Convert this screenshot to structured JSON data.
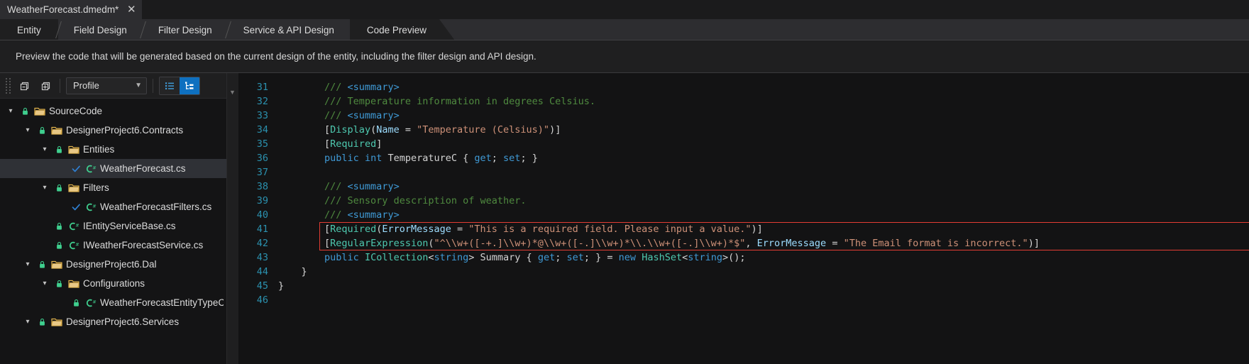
{
  "titlebar": {
    "document_tab": "WeatherForecast.dmedm*",
    "close_icon": "close-icon"
  },
  "tabs": [
    {
      "label": "Entity",
      "state": "active"
    },
    {
      "label": "Field Design",
      "state": "normal"
    },
    {
      "label": "Filter Design",
      "state": "normal"
    },
    {
      "label": "Service & API Design",
      "state": "normal"
    },
    {
      "label": "Code Preview",
      "state": "current"
    }
  ],
  "description": "Preview the code that will be generated based on the current design of the entity, including the filter design and API design.",
  "sidebar": {
    "toolbar": {
      "drag_handle": "drag-handle-icon",
      "collapse_all_icon": "collapse-all-icon",
      "expand_all_icon": "expand-all-icon",
      "profile_label": "Profile",
      "profile_chevron": "chevron-down-icon",
      "list_view_icon": "list-view-icon",
      "tree_view_icon": "tree-view-icon",
      "active_view": "tree"
    },
    "tree": [
      {
        "label": "SourceCode",
        "depth": 0,
        "kind": "folder",
        "expanded": true,
        "lock": true,
        "check": false,
        "selected": false
      },
      {
        "label": "DesignerProject6.Contracts",
        "depth": 1,
        "kind": "folder",
        "expanded": true,
        "lock": true,
        "check": false,
        "selected": false
      },
      {
        "label": "Entities",
        "depth": 2,
        "kind": "folder",
        "expanded": true,
        "lock": true,
        "check": false,
        "selected": false
      },
      {
        "label": "WeatherForecast.cs",
        "depth": 3,
        "kind": "csharp",
        "expanded": null,
        "lock": false,
        "check": true,
        "selected": true
      },
      {
        "label": "Filters",
        "depth": 2,
        "kind": "folder",
        "expanded": true,
        "lock": true,
        "check": false,
        "selected": false
      },
      {
        "label": "WeatherForecastFilters.cs",
        "depth": 3,
        "kind": "csharp",
        "expanded": null,
        "lock": false,
        "check": true,
        "selected": false
      },
      {
        "label": "IEntityServiceBase.cs",
        "depth": 2,
        "kind": "csharp",
        "expanded": null,
        "lock": true,
        "check": false,
        "selected": false
      },
      {
        "label": "IWeatherForecastService.cs",
        "depth": 2,
        "kind": "csharp",
        "expanded": null,
        "lock": true,
        "check": false,
        "selected": false
      },
      {
        "label": "DesignerProject6.Dal",
        "depth": 1,
        "kind": "folder",
        "expanded": true,
        "lock": true,
        "check": false,
        "selected": false
      },
      {
        "label": "Configurations",
        "depth": 2,
        "kind": "folder",
        "expanded": true,
        "lock": true,
        "check": false,
        "selected": false
      },
      {
        "label": "WeatherForecastEntityTypeConfig",
        "depth": 3,
        "kind": "csharp",
        "expanded": null,
        "lock": true,
        "check": false,
        "selected": false
      },
      {
        "label": "DesignerProject6.Services",
        "depth": 1,
        "kind": "folder",
        "expanded": true,
        "lock": true,
        "check": false,
        "selected": false
      }
    ]
  },
  "editor": {
    "highlight_color": "#e23c33",
    "highlighted_lines": [
      41,
      42
    ],
    "lines": [
      {
        "n": 31,
        "tokens": [
          {
            "t": "        ",
            "c": "plain"
          },
          {
            "t": "/// ",
            "c": "comment"
          },
          {
            "t": "<summary>",
            "c": "xmldoc"
          }
        ]
      },
      {
        "n": 32,
        "tokens": [
          {
            "t": "        ",
            "c": "plain"
          },
          {
            "t": "/// Temperature information in degrees Celsius.",
            "c": "comment"
          }
        ]
      },
      {
        "n": 33,
        "tokens": [
          {
            "t": "        ",
            "c": "plain"
          },
          {
            "t": "/// ",
            "c": "comment"
          },
          {
            "t": "<summary>",
            "c": "xmldoc"
          }
        ]
      },
      {
        "n": 34,
        "tokens": [
          {
            "t": "        ",
            "c": "plain"
          },
          {
            "t": "[",
            "c": "punc"
          },
          {
            "t": "Display",
            "c": "type"
          },
          {
            "t": "(",
            "c": "punc"
          },
          {
            "t": "Name",
            "c": "param"
          },
          {
            "t": " = ",
            "c": "punc"
          },
          {
            "t": "\"Temperature (Celsius)\"",
            "c": "str"
          },
          {
            "t": ")]",
            "c": "punc"
          }
        ]
      },
      {
        "n": 35,
        "tokens": [
          {
            "t": "        ",
            "c": "plain"
          },
          {
            "t": "[",
            "c": "punc"
          },
          {
            "t": "Required",
            "c": "type"
          },
          {
            "t": "]",
            "c": "punc"
          }
        ]
      },
      {
        "n": 36,
        "tokens": [
          {
            "t": "        ",
            "c": "plain"
          },
          {
            "t": "public",
            "c": "kw"
          },
          {
            "t": " ",
            "c": "plain"
          },
          {
            "t": "int",
            "c": "kw"
          },
          {
            "t": " TemperatureC { ",
            "c": "punc"
          },
          {
            "t": "get",
            "c": "kw"
          },
          {
            "t": "; ",
            "c": "punc"
          },
          {
            "t": "set",
            "c": "kw"
          },
          {
            "t": "; }",
            "c": "punc"
          }
        ]
      },
      {
        "n": 37,
        "tokens": []
      },
      {
        "n": 38,
        "tokens": [
          {
            "t": "        ",
            "c": "plain"
          },
          {
            "t": "/// ",
            "c": "comment"
          },
          {
            "t": "<summary>",
            "c": "xmldoc"
          }
        ]
      },
      {
        "n": 39,
        "tokens": [
          {
            "t": "        ",
            "c": "plain"
          },
          {
            "t": "/// Sensory description of weather.",
            "c": "comment"
          }
        ]
      },
      {
        "n": 40,
        "tokens": [
          {
            "t": "        ",
            "c": "plain"
          },
          {
            "t": "/// ",
            "c": "comment"
          },
          {
            "t": "<summary>",
            "c": "xmldoc"
          }
        ]
      },
      {
        "n": 41,
        "tokens": [
          {
            "t": "        ",
            "c": "plain"
          },
          {
            "t": "[",
            "c": "punc"
          },
          {
            "t": "Required",
            "c": "type"
          },
          {
            "t": "(",
            "c": "punc"
          },
          {
            "t": "ErrorMessage",
            "c": "param"
          },
          {
            "t": " = ",
            "c": "punc"
          },
          {
            "t": "\"This is a required field. Please input a value.\"",
            "c": "str"
          },
          {
            "t": ")]",
            "c": "punc"
          }
        ]
      },
      {
        "n": 42,
        "tokens": [
          {
            "t": "        ",
            "c": "plain"
          },
          {
            "t": "[",
            "c": "punc"
          },
          {
            "t": "RegularExpression",
            "c": "type"
          },
          {
            "t": "(",
            "c": "punc"
          },
          {
            "t": "\"^\\\\w+([-+.]\\\\w+)*@\\\\w+([-.]\\\\w+)*\\\\.\\\\w+([-.]\\\\w+)*$\"",
            "c": "str"
          },
          {
            "t": ", ",
            "c": "punc"
          },
          {
            "t": "ErrorMessage",
            "c": "param"
          },
          {
            "t": " = ",
            "c": "punc"
          },
          {
            "t": "\"The Email format is incorrect.\"",
            "c": "str"
          },
          {
            "t": ")]",
            "c": "punc"
          }
        ]
      },
      {
        "n": 43,
        "tokens": [
          {
            "t": "        ",
            "c": "plain"
          },
          {
            "t": "public",
            "c": "kw"
          },
          {
            "t": " ",
            "c": "plain"
          },
          {
            "t": "ICollection",
            "c": "type"
          },
          {
            "t": "<",
            "c": "punc"
          },
          {
            "t": "string",
            "c": "kw"
          },
          {
            "t": "> Summary { ",
            "c": "punc"
          },
          {
            "t": "get",
            "c": "kw"
          },
          {
            "t": "; ",
            "c": "punc"
          },
          {
            "t": "set",
            "c": "kw"
          },
          {
            "t": "; } = ",
            "c": "punc"
          },
          {
            "t": "new",
            "c": "kw"
          },
          {
            "t": " ",
            "c": "plain"
          },
          {
            "t": "HashSet",
            "c": "type"
          },
          {
            "t": "<",
            "c": "punc"
          },
          {
            "t": "string",
            "c": "kw"
          },
          {
            "t": ">();",
            "c": "punc"
          }
        ]
      },
      {
        "n": 44,
        "tokens": [
          {
            "t": "    }",
            "c": "punc"
          }
        ]
      },
      {
        "n": 45,
        "tokens": [
          {
            "t": "}",
            "c": "punc"
          }
        ]
      },
      {
        "n": 46,
        "tokens": []
      }
    ]
  }
}
